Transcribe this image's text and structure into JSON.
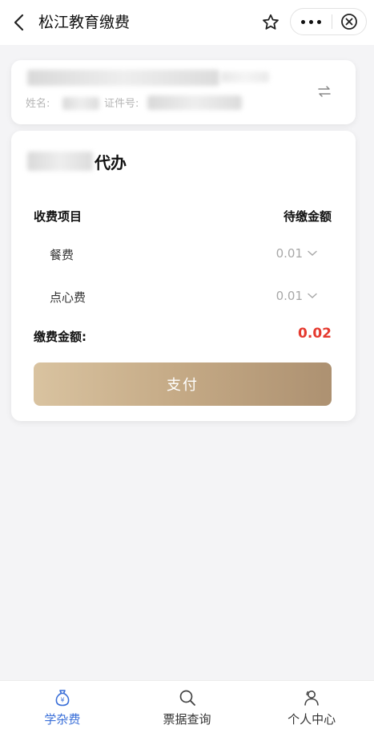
{
  "navbar": {
    "title": "松江教育缴费",
    "back_icon": "back-arrow-icon",
    "star_icon": "star-icon",
    "more_icon": "more-dots-icon",
    "close_icon": "close-circle-icon"
  },
  "student": {
    "name_label": "姓名:",
    "id_label": "证件号:",
    "swap_icon": "swap-arrows-icon"
  },
  "fee": {
    "agent_suffix": "代办",
    "header_item": "收费项目",
    "header_amount": "待缴金额",
    "items": [
      {
        "name": "餐费",
        "amount": "0.01"
      },
      {
        "name": "点心费",
        "amount": "0.01"
      }
    ],
    "total_label": "缴费金额:",
    "total_value": "0.02",
    "pay_label": "支付"
  },
  "tabbar": {
    "tabs": [
      {
        "label": "学杂费",
        "icon": "money-bag-icon",
        "active": true
      },
      {
        "label": "票据查询",
        "icon": "search-icon",
        "active": false
      },
      {
        "label": "个人中心",
        "icon": "user-icon",
        "active": false
      }
    ]
  },
  "colors": {
    "accent": "#3a6fd8",
    "total": "#e53a2f",
    "pay_gradient_start": "#d9c3a0",
    "pay_gradient_end": "#ad9171"
  }
}
